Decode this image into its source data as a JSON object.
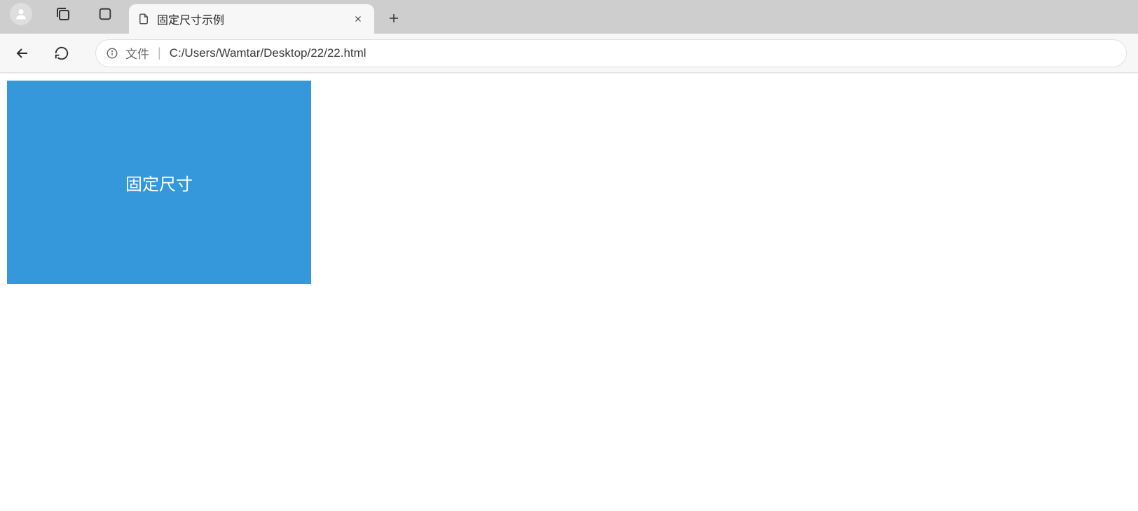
{
  "chrome": {
    "tab_title": "固定尺寸示例"
  },
  "toolbar": {
    "addr_prefix": "文件",
    "addr_sep": "|",
    "addr_path": "C:/Users/Wamtar/Desktop/22/22.html"
  },
  "page": {
    "box_label": "固定尺寸",
    "box_color": "#3498db"
  }
}
